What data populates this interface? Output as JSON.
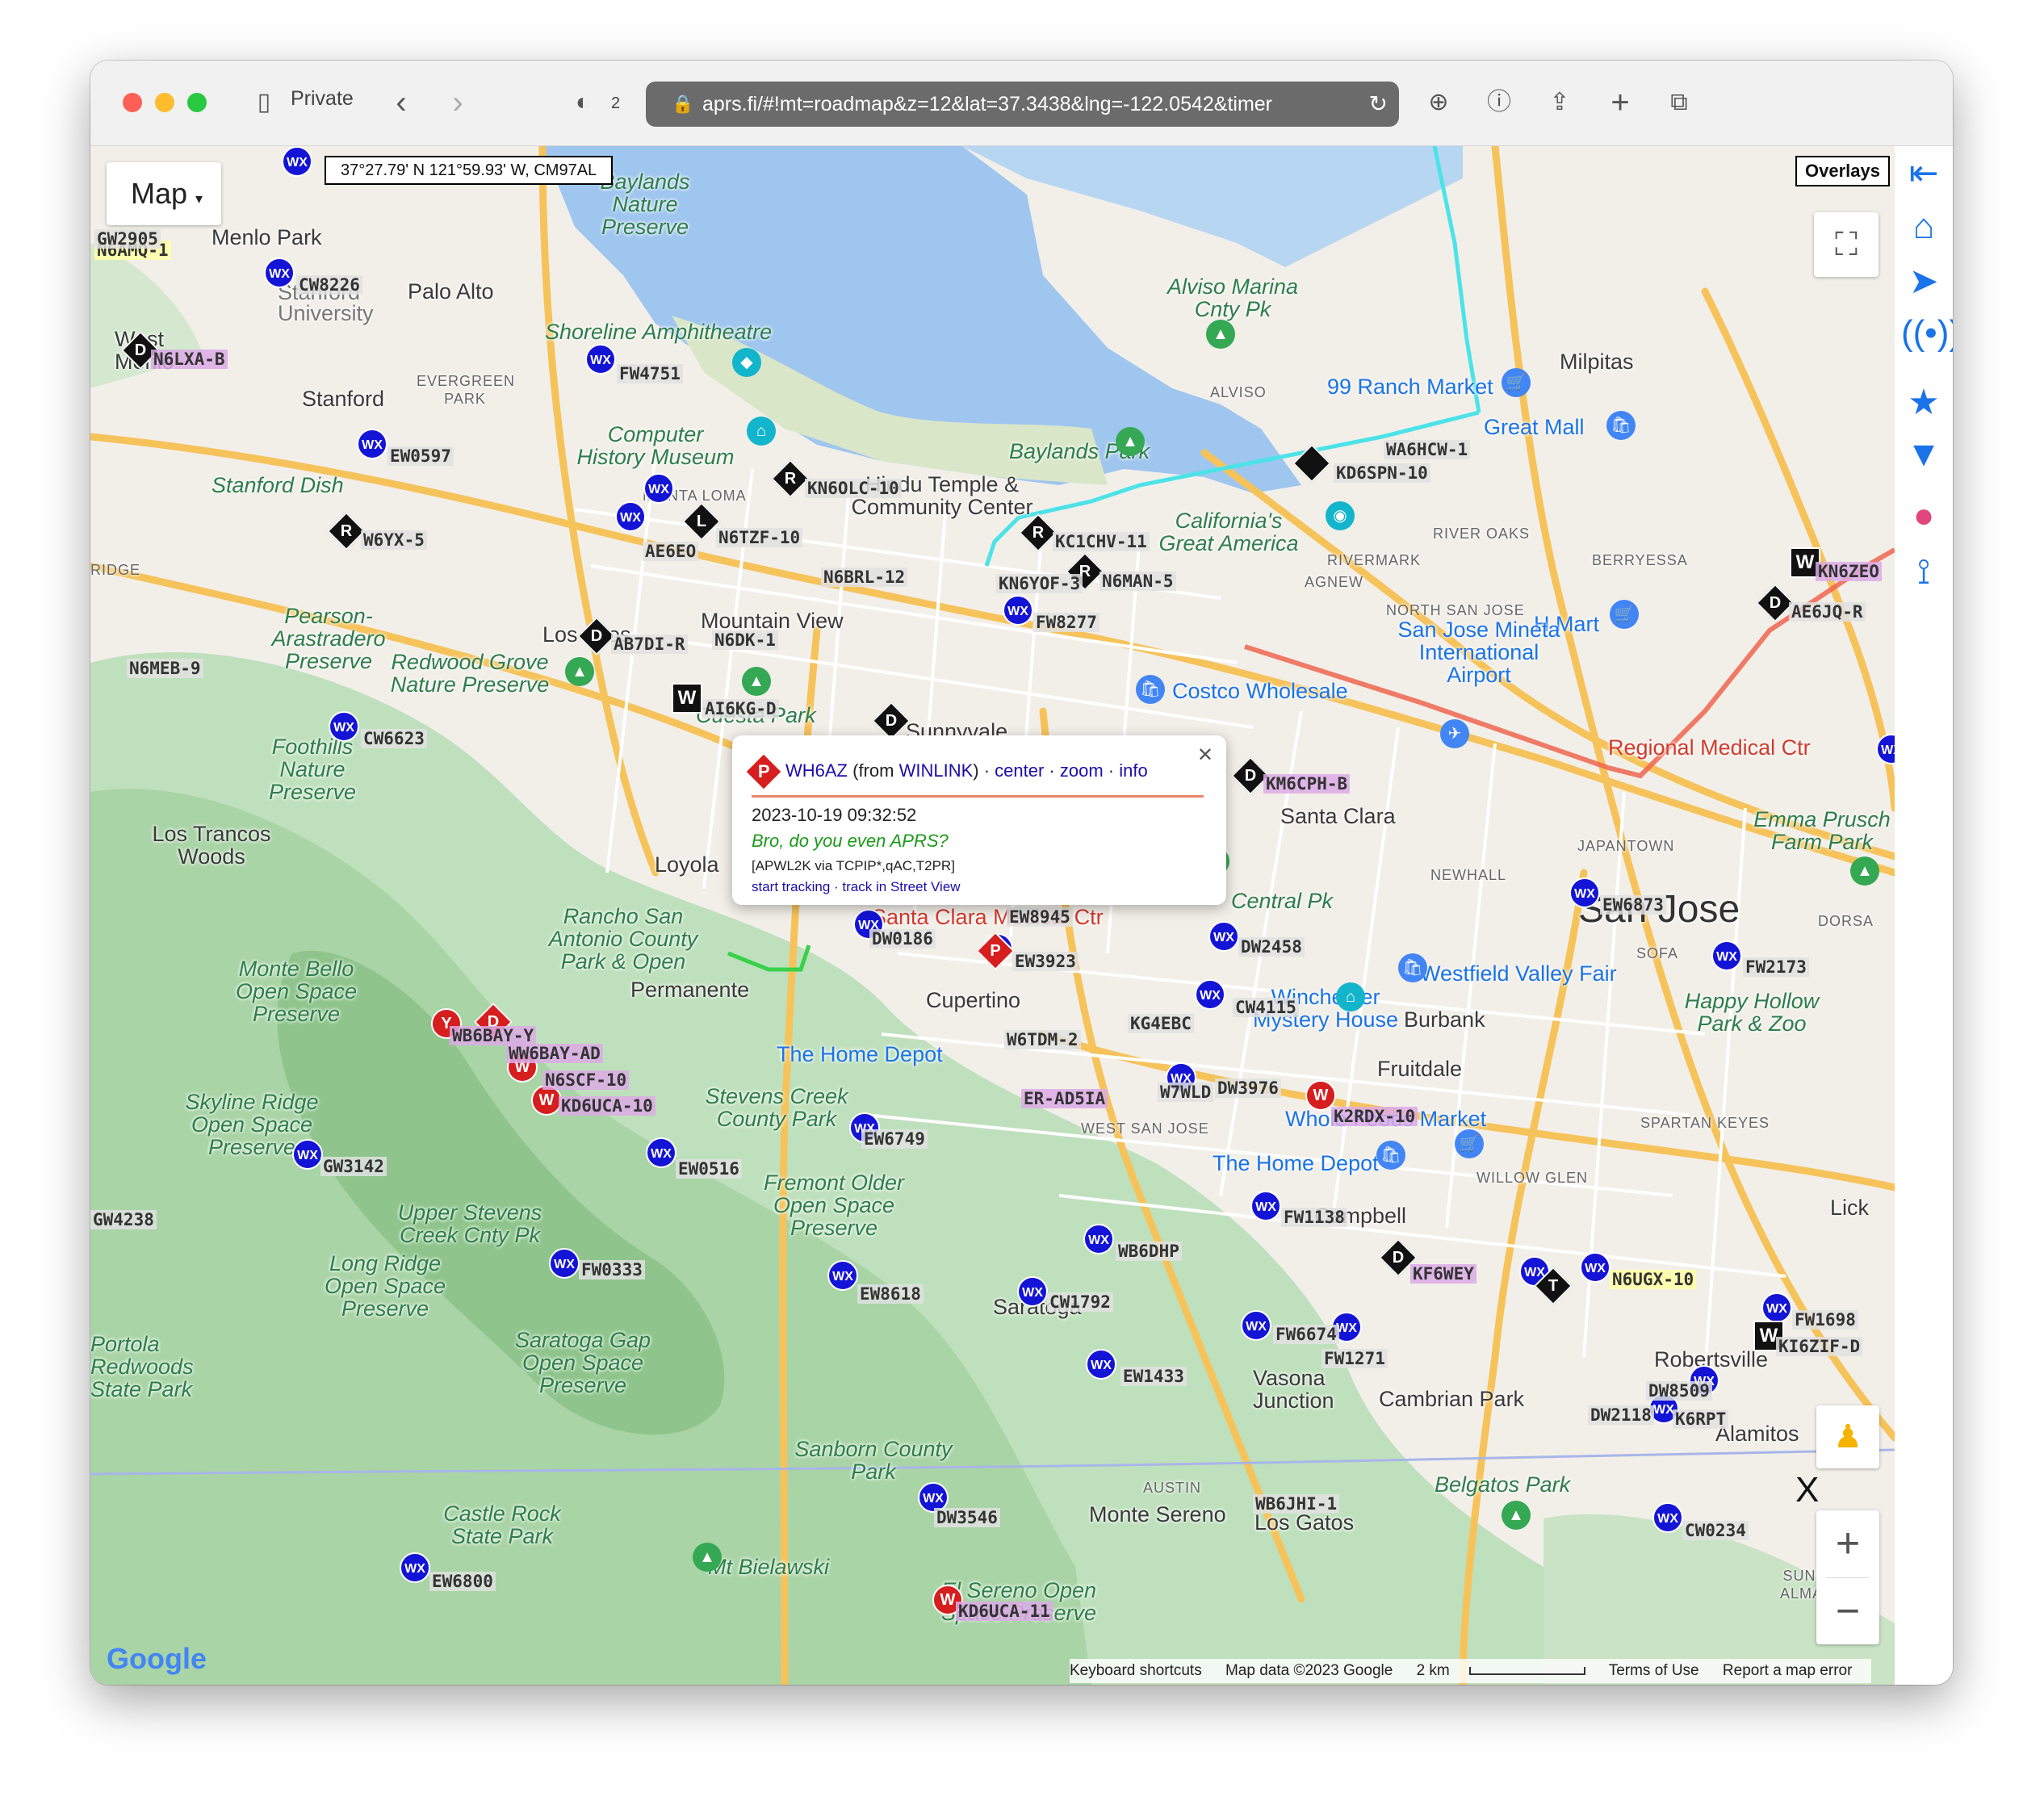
{
  "browser": {
    "private_label": "Private",
    "tab_count": "2",
    "url": "aprs.fi/#!mt=roadmap&z=12&lat=37.3438&lng=-122.0542&timer"
  },
  "map": {
    "type_label": "Map",
    "coord_readout": "37°27.79' N 121°59.93' W, CM97AL",
    "overlays_label": "Overlays",
    "google_logo": "Google",
    "attribution": {
      "shortcuts": "Keyboard shortcuts",
      "data": "Map data ©2023 Google",
      "scale": "2 km",
      "terms": "Terms of Use",
      "report": "Report a map error"
    },
    "places": [
      {
        "name": "Menlo Park",
        "cls": ""
      },
      {
        "name": "Palo Alto",
        "cls": ""
      },
      {
        "name": "Stanford",
        "cls": ""
      },
      {
        "name": "Stanford University",
        "cls": ""
      },
      {
        "name": "Milpitas",
        "cls": ""
      },
      {
        "name": "Santa Clara",
        "cls": ""
      },
      {
        "name": "San Jose",
        "cls": "big"
      },
      {
        "name": "Cupertino",
        "cls": ""
      },
      {
        "name": "Burbank",
        "cls": ""
      },
      {
        "name": "Fruitdale",
        "cls": ""
      },
      {
        "name": "Campbell",
        "cls": ""
      },
      {
        "name": "Saratoga",
        "cls": ""
      },
      {
        "name": "Monte Sereno",
        "cls": ""
      },
      {
        "name": "Los Gatos",
        "cls": ""
      },
      {
        "name": "Vasona Junction",
        "cls": ""
      },
      {
        "name": "Cambrian Park",
        "cls": ""
      },
      {
        "name": "Robertsville",
        "cls": ""
      },
      {
        "name": "Alamitos",
        "cls": ""
      },
      {
        "name": "Loyola",
        "cls": ""
      },
      {
        "name": "Los Altos",
        "cls": ""
      },
      {
        "name": "Mountain View",
        "cls": ""
      },
      {
        "name": "Sunnyvale",
        "cls": ""
      },
      {
        "name": "Permanente",
        "cls": ""
      },
      {
        "name": "West Menlo",
        "cls": ""
      },
      {
        "name": "Los Trancos Woods",
        "cls": ""
      },
      {
        "name": "Lick",
        "cls": ""
      },
      {
        "name": "Shoreline Amphitheatre",
        "cls": "green"
      },
      {
        "name": "Computer History Museum",
        "cls": "green"
      },
      {
        "name": "Baylands Park",
        "cls": "green"
      },
      {
        "name": "Alviso Marina Cnty Pk",
        "cls": "green"
      },
      {
        "name": "Stanford Dish",
        "cls": "green"
      },
      {
        "name": "Pearson-Arastradero Preserve",
        "cls": "green"
      },
      {
        "name": "Redwood Grove Nature Preserve",
        "cls": "green"
      },
      {
        "name": "Foothills Nature Preserve",
        "cls": "green"
      },
      {
        "name": "Rancho San Antonio County Park & Open",
        "cls": "green"
      },
      {
        "name": "Monte Bello Open Space Preserve",
        "cls": "green"
      },
      {
        "name": "Skyline Ridge Open Space Preserve",
        "cls": "green"
      },
      {
        "name": "Stevens Creek County Park",
        "cls": "green"
      },
      {
        "name": "Fremont Older Open Space Preserve",
        "cls": "green"
      },
      {
        "name": "Upper Stevens Creek Cnty Pk",
        "cls": "green"
      },
      {
        "name": "Long Ridge Open Space Preserve",
        "cls": "green"
      },
      {
        "name": "Saratoga Gap Open Space Preserve",
        "cls": "green"
      },
      {
        "name": "Sanborn County Park",
        "cls": "green"
      },
      {
        "name": "Castle Rock State Park",
        "cls": "green"
      },
      {
        "name": "Mt Bielawski",
        "cls": "green"
      },
      {
        "name": "El Sereno Open Space Preserve",
        "cls": "green"
      },
      {
        "name": "Belgatos Park",
        "cls": "green"
      },
      {
        "name": "Happy Hollow Park & Zoo",
        "cls": "green"
      },
      {
        "name": "Emma Prusch Farm Park",
        "cls": "green"
      },
      {
        "name": "Portola Redwoods State Park",
        "cls": "green"
      },
      {
        "name": "Baylands Nature Preserve",
        "cls": "green"
      },
      {
        "name": "Cuesta Park",
        "cls": "green"
      },
      {
        "name": "Central Pk",
        "cls": "green"
      },
      {
        "name": "99 Ranch Market",
        "cls": "blue"
      },
      {
        "name": "Great Mall",
        "cls": "blue"
      },
      {
        "name": "Costco Wholesale",
        "cls": "blue"
      },
      {
        "name": "H Mart",
        "cls": "blue"
      },
      {
        "name": "San Jose Mineta International Airport",
        "cls": "blue"
      },
      {
        "name": "Westfield Valley Fair",
        "cls": "blue"
      },
      {
        "name": "The Home Depot",
        "cls": "blue"
      },
      {
        "name": "The Home Depot",
        "cls": "blue"
      },
      {
        "name": "Winchester Mystery House",
        "cls": "blue"
      },
      {
        "name": "Whole Foods Market",
        "cls": "blue"
      },
      {
        "name": "California's Great America",
        "cls": "green"
      },
      {
        "name": "Hindu Temple & Community Center",
        "cls": ""
      },
      {
        "name": "Regional Medical Ctr",
        "cls": "red"
      },
      {
        "name": "Santa Clara Medical Ctr",
        "cls": "red"
      },
      {
        "name": "NORTH SAN JOSE",
        "cls": "small"
      },
      {
        "name": "RIVER OAKS",
        "cls": "small"
      },
      {
        "name": "BERRYESSA",
        "cls": "small"
      },
      {
        "name": "JAPANTOWN",
        "cls": "small"
      },
      {
        "name": "NEWHALL",
        "cls": "small"
      },
      {
        "name": "SOFA",
        "cls": "small"
      },
      {
        "name": "DORSA",
        "cls": "small"
      },
      {
        "name": "WEST SAN JOSE",
        "cls": "small"
      },
      {
        "name": "WILLOW GLEN",
        "cls": "small"
      },
      {
        "name": "SPARTAN KEYES",
        "cls": "small"
      },
      {
        "name": "AUSTIN",
        "cls": "small"
      },
      {
        "name": "MONTA LOMA",
        "cls": "small"
      },
      {
        "name": "EVERGREEN PARK",
        "cls": "small"
      },
      {
        "name": "ALVISO",
        "cls": "small"
      },
      {
        "name": "RIVERMARK",
        "cls": "small"
      },
      {
        "name": "AGNEW",
        "cls": "small"
      },
      {
        "name": "SUNRISE ALMADEN",
        "cls": "small"
      },
      {
        "name": "RIDGE",
        "cls": "small"
      }
    ],
    "stations": [
      {
        "call": "N6AMQ-1",
        "style": "yellow"
      },
      {
        "call": "CW8226",
        "style": ""
      },
      {
        "call": "N6LXA-B",
        "style": "pink"
      },
      {
        "call": "EW0597",
        "style": ""
      },
      {
        "call": "W6YX-5",
        "style": ""
      },
      {
        "call": "FW4751",
        "style": ""
      },
      {
        "call": "AE6EO",
        "style": ""
      },
      {
        "call": "N6TZF-10",
        "style": ""
      },
      {
        "call": "KN6OLC-10",
        "style": ""
      },
      {
        "call": "N6BRL-12",
        "style": ""
      },
      {
        "call": "KC1CHV-11",
        "style": ""
      },
      {
        "call": "KN6YOF-3",
        "style": ""
      },
      {
        "call": "N6MAN-5",
        "style": ""
      },
      {
        "call": "FW8277",
        "style": ""
      },
      {
        "call": "AB7DI-R",
        "style": ""
      },
      {
        "call": "N6DK-1",
        "style": ""
      },
      {
        "call": "N6MEB-9",
        "style": ""
      },
      {
        "call": "AI6KG-D",
        "style": ""
      },
      {
        "call": "CW6623",
        "style": ""
      },
      {
        "call": "WA6HCW-1",
        "style": ""
      },
      {
        "call": "KD6SPN-10",
        "style": ""
      },
      {
        "call": "KN6ZEO",
        "style": "pink"
      },
      {
        "call": "AE6JQ-R",
        "style": ""
      },
      {
        "call": "KM6CPH-B",
        "style": "pink"
      },
      {
        "call": "EW8945",
        "style": ""
      },
      {
        "call": "DW0186",
        "style": ""
      },
      {
        "call": "EW3923",
        "style": ""
      },
      {
        "call": "DW2458",
        "style": ""
      },
      {
        "call": "EW6873",
        "style": ""
      },
      {
        "call": "FW2173",
        "style": ""
      },
      {
        "call": "CW4115",
        "style": ""
      },
      {
        "call": "KG4EBC",
        "style": ""
      },
      {
        "call": "W6TDM-2",
        "style": ""
      },
      {
        "call": "ER-AD5IA",
        "style": "pink"
      },
      {
        "call": "W7WLD",
        "style": ""
      },
      {
        "call": "DW3976",
        "style": ""
      },
      {
        "call": "K2RDX-10",
        "style": "pink"
      },
      {
        "call": "WB6BAY-Y",
        "style": "pink"
      },
      {
        "call": "WW6BAY-AD",
        "style": "pink"
      },
      {
        "call": "N6SCF-10",
        "style": "pink"
      },
      {
        "call": "KD6UCA-10",
        "style": "pink"
      },
      {
        "call": "GW3142",
        "style": ""
      },
      {
        "call": "EW0516",
        "style": ""
      },
      {
        "call": "EW6749",
        "style": ""
      },
      {
        "call": "FW1138",
        "style": ""
      },
      {
        "call": "KF6WEY",
        "style": "pink"
      },
      {
        "call": "N6UGX-10",
        "style": "yellow"
      },
      {
        "call": "WB6DHP",
        "style": ""
      },
      {
        "call": "FW0333",
        "style": ""
      },
      {
        "call": "EW8618",
        "style": ""
      },
      {
        "call": "CW1792",
        "style": ""
      },
      {
        "call": "EW1433",
        "style": ""
      },
      {
        "call": "FW6674",
        "style": ""
      },
      {
        "call": "FW1271",
        "style": ""
      },
      {
        "call": "FW1698",
        "style": ""
      },
      {
        "call": "KI6ZIF-D",
        "style": ""
      },
      {
        "call": "DW8509",
        "style": ""
      },
      {
        "call": "DW2118",
        "style": ""
      },
      {
        "call": "K6RPT",
        "style": ""
      },
      {
        "call": "WB6JHI-1",
        "style": ""
      },
      {
        "call": "DW3546",
        "style": ""
      },
      {
        "call": "CW0234",
        "style": ""
      },
      {
        "call": "EW6800",
        "style": ""
      },
      {
        "call": "KD6UCA-11",
        "style": "pink"
      },
      {
        "call": "GW4238",
        "style": ""
      },
      {
        "call": "GW2905",
        "style": ""
      }
    ]
  },
  "popup": {
    "callsign": "WH6AZ",
    "via_prefix": "(from ",
    "via": "WINLINK",
    "via_suffix": ")",
    "links": [
      "center",
      "zoom",
      "info"
    ],
    "time": "2023-10-19 09:32:52",
    "status": "Bro, do you even APRS?",
    "path": "[APWL2K via TCPIP*,qAC,T2PR]",
    "track_links": [
      "start tracking",
      "track in Street View"
    ],
    "symbol": "P"
  },
  "right_panel": {
    "icons": [
      "back-arrow-icon",
      "home-icon",
      "locate-icon",
      "antenna-icon",
      "star-icon",
      "filter-icon",
      "theme-icon",
      "compass-icon"
    ]
  }
}
